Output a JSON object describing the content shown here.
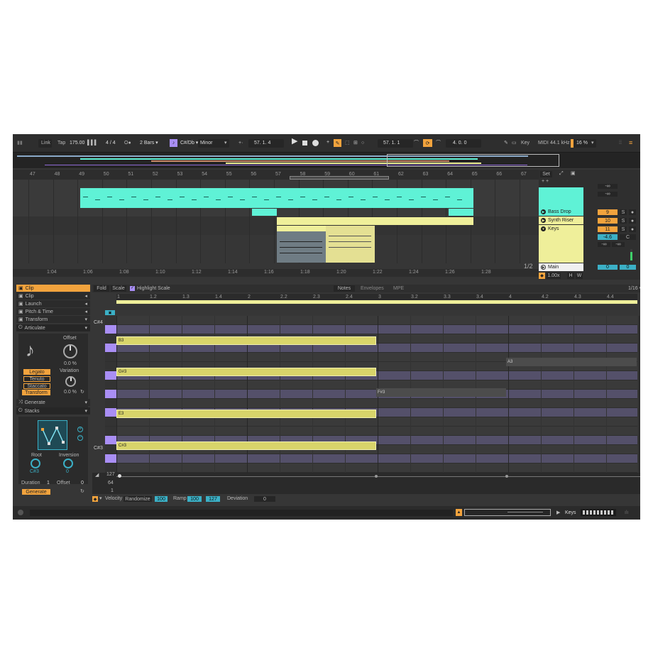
{
  "toolbar": {
    "link": "Link",
    "tap": "Tap",
    "tempo": "175.00",
    "sig": "4 / 4",
    "quant": "2 Bars ▾",
    "key": "C#/Db ▾",
    "scale": "Minor",
    "pos1": "57.   1.   4",
    "pos2": "57.   1.   1",
    "pos3": "4.   0.   0",
    "keylbl": "Key",
    "midi": "MIDI",
    "rate": "44.1 kHz",
    "cpu": "16 %"
  },
  "ruler": [
    "47",
    "48",
    "49",
    "50",
    "51",
    "52",
    "53",
    "54",
    "55",
    "56",
    "57",
    "58",
    "59",
    "60",
    "61",
    "62",
    "63",
    "64",
    "65",
    "66",
    "67"
  ],
  "timeruler": [
    "1:04",
    "1:06",
    "1:08",
    "1:10",
    "1:12",
    "1:14",
    "1:16",
    "1:18",
    "1:20",
    "1:22",
    "1:24",
    "1:26",
    "1:28"
  ],
  "mixer": {
    "set": "Set",
    "tracks": [
      {
        "name": "Bass Drop",
        "num": "9",
        "s": "S"
      },
      {
        "name": "Synth Riser",
        "num": "10",
        "s": "S"
      },
      {
        "name": "Keys",
        "num": "11",
        "s": "S",
        "vol": "-4.6",
        "c": "C"
      }
    ],
    "inf": "-∞",
    "main": "Main",
    "mainval": "0",
    "zoom": "1.00x",
    "h": "H",
    "w": "W",
    "page": "1/2"
  },
  "clipview": {
    "title": "Clip",
    "fold": "Fold",
    "scale": "Scale",
    "hl": "Highlight Scale",
    "tabs": [
      "Notes",
      "Envelopes",
      "MPE"
    ],
    "grid": "1/16 ▾",
    "bars": [
      "1",
      "1.2",
      "1.3",
      "1.4",
      "2",
      "2.2",
      "2.3",
      "2.4",
      "3",
      "3.2",
      "3.3",
      "3.4",
      "4",
      "4.2",
      "4.3",
      "4.4"
    ]
  },
  "sidebar": {
    "items": [
      "Clip",
      "Launch",
      "Pitch & Time",
      "Transform"
    ],
    "articulate": "Articulate",
    "offset": "Offset",
    "offval": "0.0 %",
    "variation": "Variation",
    "varval": "0.0 %",
    "legato": "Legato",
    "tenuto": "Tenuto",
    "staccato": "Staccato",
    "transform": "Transform",
    "generate_hdr": "Generate",
    "stacks": "Stacks",
    "root": "Root",
    "rootval": "C#3",
    "inversion": "Inversion",
    "invval": "0",
    "duration": "Duration",
    "durval": "1",
    "offset2": "Offset",
    "off2val": "0",
    "generate": "Generate"
  },
  "notes": {
    "pitch_labels": [
      "C#4",
      "C#3"
    ],
    "notes": [
      {
        "label": "B3"
      },
      {
        "label": "G#3"
      },
      {
        "label": "E3"
      },
      {
        "label": "C#3"
      },
      {
        "label": "A3"
      },
      {
        "label": "F#3"
      }
    ]
  },
  "velocity": {
    "top": "127",
    "mid": "64",
    "low": "1",
    "label": "Velocity",
    "randomize": "Randomize",
    "randval": "100",
    "ramp": "Ramp",
    "rampval": "100",
    "rampval2": "127",
    "deviation": "Deviation",
    "devval": "0"
  },
  "status": {
    "track": "Keys"
  },
  "colors": {
    "cyan": "#5ff2d6",
    "yellow": "#efef9a",
    "orange": "#f2a33d",
    "purple": "#a98ef5",
    "lane": "#54506a"
  }
}
